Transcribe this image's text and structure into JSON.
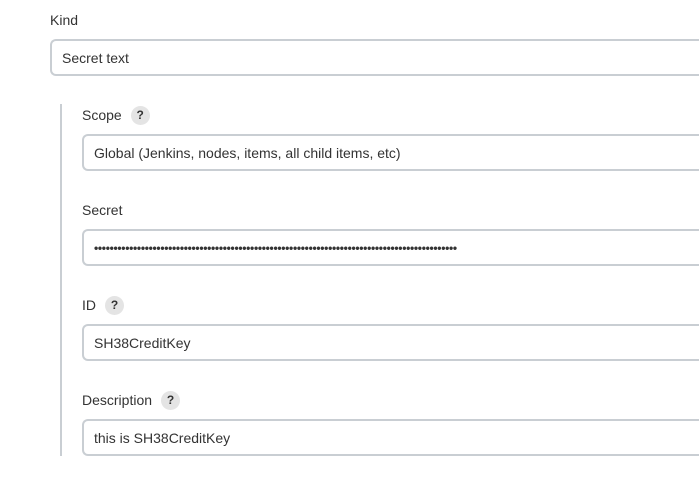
{
  "kind": {
    "label": "Kind",
    "value": "Secret text"
  },
  "scope": {
    "label": "Scope",
    "help": "?",
    "value": "Global (Jenkins, nodes, items, all child items, etc)"
  },
  "secret": {
    "label": "Secret",
    "value": "•••••••••••••••••••••••••••••••••••••••••••••••••••••••••••••••••••••••••••••••••••••••••••••"
  },
  "id": {
    "label": "ID",
    "help": "?",
    "value": "SH38CreditKey"
  },
  "description": {
    "label": "Description",
    "help": "?",
    "value": "this is SH38CreditKey"
  }
}
